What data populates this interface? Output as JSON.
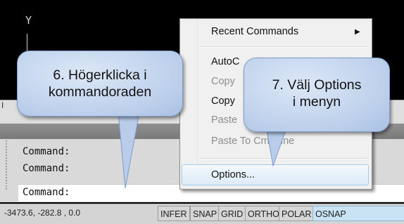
{
  "drawing_area": {
    "ucs_y_label": "Y",
    "tab_fragment": "I"
  },
  "command_window": {
    "history": [
      "Command:",
      "Command:"
    ],
    "prompt": "Command:"
  },
  "status_bar": {
    "coordinates": "-3473.6, -282.8 , 0.0",
    "buttons": [
      {
        "label": "INFER",
        "active": false
      },
      {
        "label": "SNAP",
        "active": false
      },
      {
        "label": "GRID",
        "active": false
      },
      {
        "label": "ORTHO",
        "active": false
      },
      {
        "label": "POLAR",
        "active": false
      },
      {
        "label": "OSNAP",
        "active": true
      }
    ]
  },
  "context_menu": {
    "items": [
      {
        "label": "Recent Commands",
        "has_submenu": true,
        "disabled": false
      },
      {
        "label": "AutoC",
        "disabled": false
      },
      {
        "label": "Copy",
        "disabled": true
      },
      {
        "label": "Copy",
        "disabled": false
      },
      {
        "label": "Paste",
        "disabled": true
      },
      {
        "label": "Paste To CmdLine",
        "disabled": true
      },
      {
        "label": "Options...",
        "disabled": false,
        "highlighted": true
      }
    ]
  },
  "callouts": {
    "step6": {
      "line1": "6. Högerklicka i",
      "line2": "kommandoraden"
    },
    "step7": {
      "line1": "7. Välj Options",
      "line2": "i menyn"
    }
  },
  "colors": {
    "drawing_background": "#000000",
    "callout_fill": "#b9cdea",
    "menu_highlight": "#dcebf8",
    "active_status_button": "#c9e3f4"
  }
}
